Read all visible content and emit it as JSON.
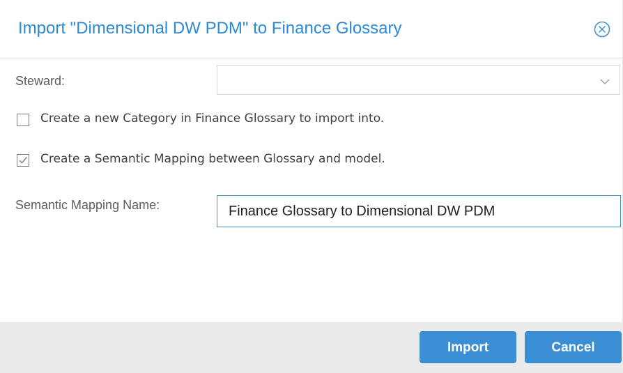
{
  "dialog": {
    "title": "Import \"Dimensional DW PDM\" to Finance Glossary",
    "title_color": "#2b8ad6",
    "close_icon": "close-circle-icon"
  },
  "form": {
    "steward_label": "Steward:",
    "steward_value": "",
    "create_category": {
      "label": "Create a new Category in Finance Glossary to import into.",
      "checked": false
    },
    "create_mapping": {
      "label": "Create a Semantic Mapping between Glossary and model.",
      "checked": true
    },
    "mapping_name_label": "Semantic Mapping Name:",
    "mapping_name_value": "Finance Glossary to Dimensional DW PDM"
  },
  "footer": {
    "import_label": "Import",
    "cancel_label": "Cancel",
    "button_color": "#3a8ed4"
  }
}
